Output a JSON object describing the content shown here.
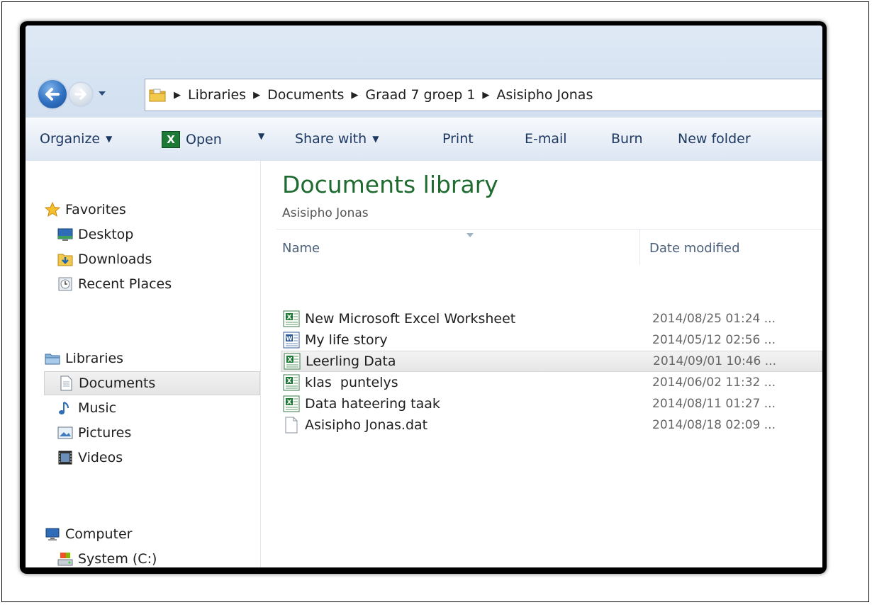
{
  "address": {
    "crumbs": [
      "Libraries",
      "Documents",
      "Graad 7 groep 1",
      "Asisipho Jonas"
    ]
  },
  "toolbar": {
    "organize": "Organize",
    "open": "Open",
    "share": "Share with",
    "print": "Print",
    "email": "E-mail",
    "burn": "Burn",
    "new_folder": "New folder"
  },
  "navpane": {
    "favorites": "Favorites",
    "desktop": "Desktop",
    "downloads": "Downloads",
    "recent": "Recent Places",
    "libraries": "Libraries",
    "documents": "Documents",
    "music": "Music",
    "pictures": "Pictures",
    "videos": "Videos",
    "computer": "Computer",
    "system": "System (C:)"
  },
  "content": {
    "title": "Documents library",
    "subtitle": "Asisipho Jonas",
    "col_name": "Name",
    "col_date": "Date modified",
    "files": [
      {
        "name": "New Microsoft Excel Worksheet",
        "date": "2014/08/25 01:24 ...",
        "type": "excel"
      },
      {
        "name": "My life story",
        "date": "2014/05/12 02:56 ...",
        "type": "word"
      },
      {
        "name": "Leerling Data",
        "date": "2014/09/01 10:46 ...",
        "type": "excel"
      },
      {
        "name": "klas  puntelys",
        "date": "2014/06/02 11:32 ...",
        "type": "excel"
      },
      {
        "name": "Data hateering taak",
        "date": "2014/08/11 01:27 ...",
        "type": "excel"
      },
      {
        "name": "Asisipho Jonas.dat",
        "date": "2014/08/18 02:09 ...",
        "type": "file"
      }
    ]
  },
  "colors": {
    "title_green": "#1e6b30",
    "toolbar_text": "#1e3961"
  }
}
